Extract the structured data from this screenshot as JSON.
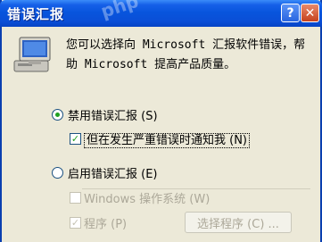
{
  "title": "错误汇报",
  "watermark": "php",
  "titlebar": {
    "help_glyph": "?",
    "close_glyph": "✕"
  },
  "icon": "computer-with-monitor-icon",
  "message": "您可以选择向 Microsoft 汇报软件错误，帮助 Microsoft 提高产品质量。",
  "options": {
    "disable_label": "禁用错误汇报 (S)",
    "notify_label": "但在发生严重错误时通知我 (N)",
    "enable_label": "启用错误汇报 (E)",
    "windows_label": "Windows 操作系统 (W)",
    "programs_label": "程序 (P)",
    "choose_programs_label": "选择程序 (C) ..."
  },
  "state": {
    "disable_selected": true,
    "notify_checked": true,
    "enable_selected": false,
    "windows_checked": false,
    "programs_checked": true
  }
}
